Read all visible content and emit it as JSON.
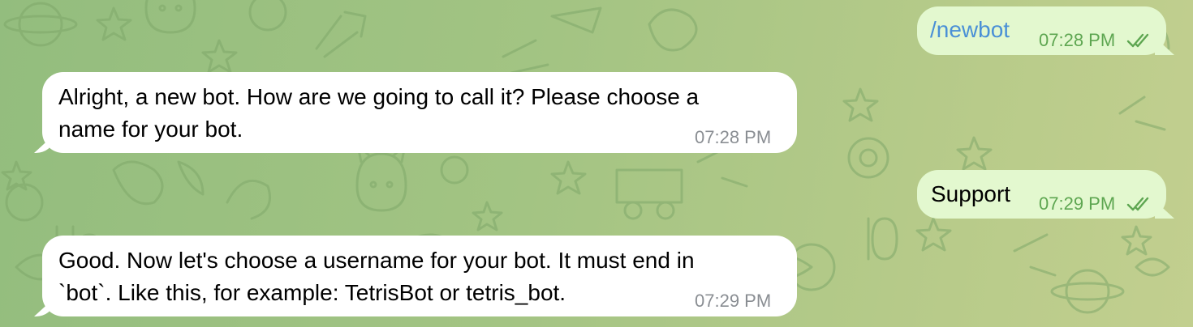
{
  "chat": {
    "messages": [
      {
        "id": "m1",
        "direction": "outgoing",
        "kind": "command",
        "text": "/newbot",
        "time": "07:28 PM",
        "status": "read"
      },
      {
        "id": "m2",
        "direction": "incoming",
        "kind": "text",
        "lines": [
          "Alright, a new bot. How are we going to call it? Please choose a",
          "name for your bot."
        ],
        "time": "07:28 PM"
      },
      {
        "id": "m3",
        "direction": "outgoing",
        "kind": "text",
        "text": "Support",
        "time": "07:29 PM",
        "status": "read"
      },
      {
        "id": "m4",
        "direction": "incoming",
        "kind": "text",
        "lines": [
          "Good. Now let's choose a username for your bot. It must end in",
          "`bot`. Like this, for example: TetrisBot or tetris_bot."
        ],
        "time": "07:29 PM"
      }
    ]
  },
  "colors": {
    "background": "#a3c483",
    "incoming_bubble": "#ffffff",
    "outgoing_bubble": "#e3f8cf",
    "command_link": "#4a90d6",
    "outgoing_meta": "#5ea651",
    "incoming_meta": "#8a8e93"
  },
  "icons": {
    "read_status": "double-check-icon"
  }
}
